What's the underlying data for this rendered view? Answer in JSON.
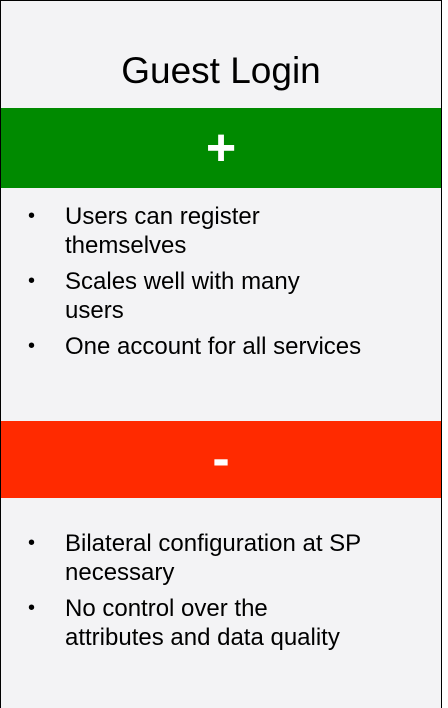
{
  "title": "Guest Login",
  "colors": {
    "card_background": "#f3f3f5",
    "pros_band": "#008a00",
    "cons_band": "#ff2a00",
    "band_text": "#ffffff"
  },
  "pros": {
    "symbol": "+",
    "items": [
      {
        "line1": "Users can register",
        "line2": "themselves"
      },
      {
        "line1": "Scales well with many",
        "line2": "users"
      },
      {
        "line1": "One account for all services",
        "line2": ""
      }
    ]
  },
  "cons": {
    "symbol": "-",
    "items": [
      {
        "line1": "Bilateral configuration at SP",
        "line2": "necessary"
      },
      {
        "line1": "No control over the",
        "line2": "attributes and data quality"
      }
    ]
  },
  "bullet_glyph": "•"
}
